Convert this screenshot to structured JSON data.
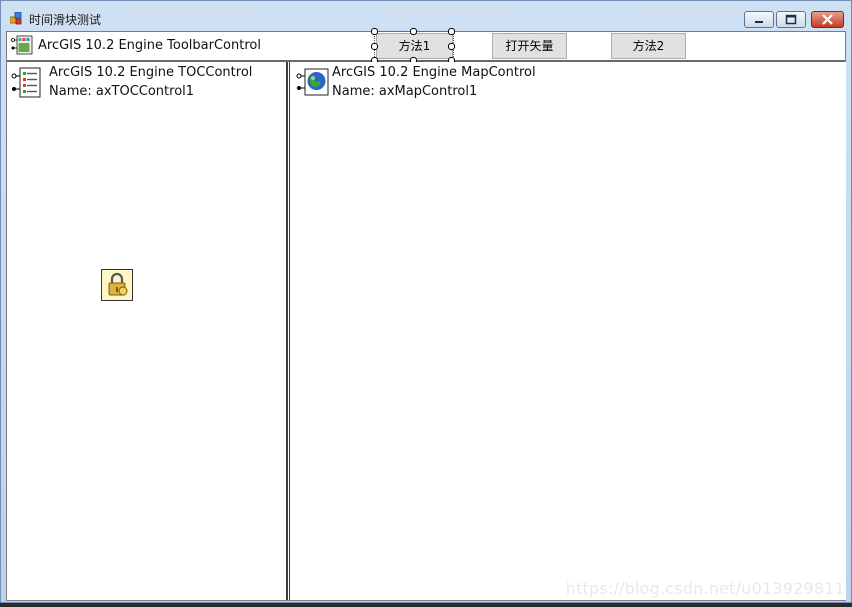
{
  "window": {
    "title": "时间滑块测试",
    "icon": "winforms-app-icon"
  },
  "toolbar": {
    "control_label": "ArcGIS 10.2 Engine ToolbarControl",
    "buttons": {
      "method1": "方法1",
      "open_vector": "打开矢量",
      "method2": "方法2"
    }
  },
  "toc": {
    "line1": "ArcGIS 10.2 Engine TOCControl",
    "line2": "Name: axTOCControl1"
  },
  "map": {
    "line1": "ArcGIS 10.2 Engine MapControl",
    "line2": "Name: axMapControl1"
  },
  "watermark": "https://blog.csdn.net/u013929811",
  "colors": {
    "title_bar": "#c6daf1",
    "close_button": "#c9452b",
    "button_face": "#e1e1e1"
  }
}
